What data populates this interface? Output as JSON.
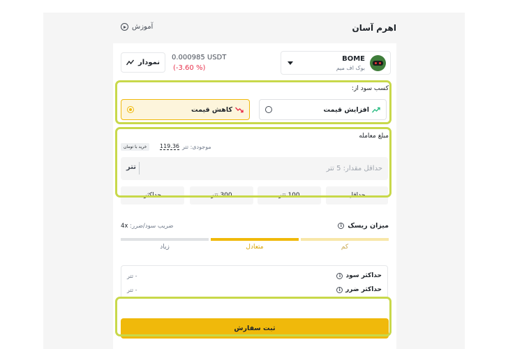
{
  "header": {
    "title": "اهرم آسان",
    "tutorial_label": "آموزش"
  },
  "asset": {
    "symbol": "BOME",
    "name": "بوک اف میم",
    "price": "0.000985 USDT",
    "change": "(-3.60 %)",
    "chart_button": "نمودار"
  },
  "profit": {
    "label": "کسب سود از:",
    "options": [
      {
        "label": "افزایش قیمت",
        "selected": false
      },
      {
        "label": "کاهش قیمت",
        "selected": true
      }
    ]
  },
  "amount": {
    "label": "مبلغ معامله",
    "balance_label": "موجودی: تتر",
    "balance_value": "119.36",
    "buy_toman": "خرید با تومان",
    "placeholder": "حداقل مقدار: 5 تتر",
    "unit": "تتر",
    "quick": [
      "حداقل",
      "100 تتر",
      "300 تتر",
      "حداکثر"
    ]
  },
  "risk": {
    "title": "میزان ریسک",
    "multiplier_label": "ضریب سود/ضرر:",
    "multiplier_value": "4x",
    "levels": [
      "کم",
      "متعادل",
      "زیاد"
    ],
    "selected": "متعادل"
  },
  "limits": {
    "max_profit_label": "حداکثر سود",
    "max_profit_value": "- تتر",
    "max_loss_label": "حداکثر ضرر",
    "max_loss_value": "- تتر"
  },
  "submit_label": "ثبت سفارش",
  "colors": {
    "accent": "#f0b90b",
    "highlight": "#c8d84a",
    "down": "#e8304b",
    "up": "#2ebd85"
  }
}
